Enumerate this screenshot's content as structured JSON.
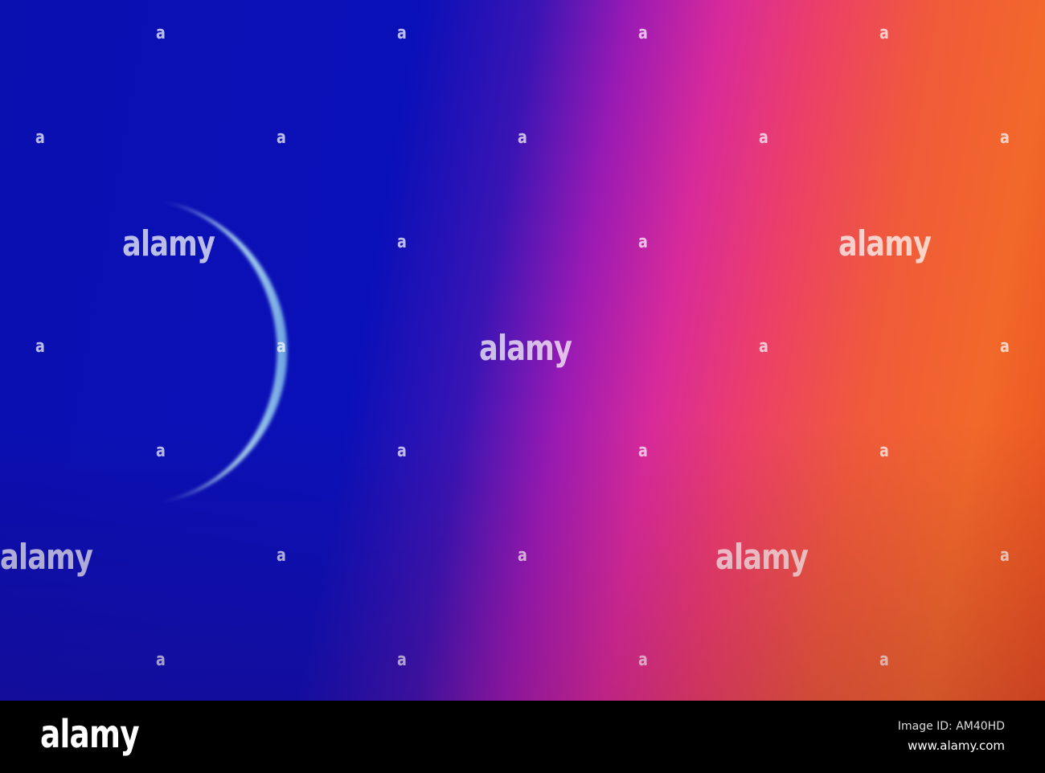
{
  "photo": {
    "subject": "crescent-moon",
    "colors": {
      "sky_left": "#0a0fb0",
      "sky_mid": "#d82a9a",
      "sky_right": "#f2682a",
      "moon": "#cfe8ff"
    },
    "watermark_small": "a",
    "watermark_word": "alamy"
  },
  "footer": {
    "logo": "alamy",
    "image_id": "Image ID: AM40HD",
    "url": "www.alamy.com"
  }
}
